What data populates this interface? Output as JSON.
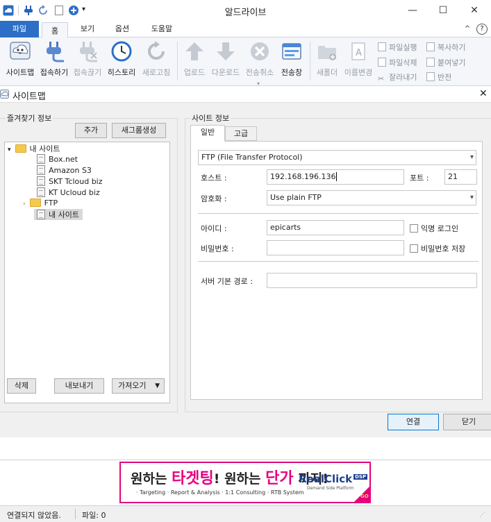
{
  "window": {
    "title": "알드라이브",
    "minimize": "—",
    "maximize": "☐",
    "close": "✕"
  },
  "ribbon_tabs": [
    "파일",
    "홈",
    "보기",
    "옵션",
    "도움말"
  ],
  "ribbon_right": {
    "up": "^",
    "help": "?"
  },
  "ribbon": {
    "large_buttons": [
      {
        "label": "사이트맵",
        "icon": "sitemap-icon"
      },
      {
        "label": "접속하기",
        "icon": "connect-plug-icon"
      },
      {
        "label": "접속끊기",
        "icon": "disconnect-plug-icon"
      },
      {
        "label": "히스토리",
        "icon": "clock-icon"
      },
      {
        "label": "새로고침",
        "icon": "refresh-icon"
      },
      {
        "label": "업로드",
        "icon": "upload-arrow-icon"
      },
      {
        "label": "다운로드",
        "icon": "download-arrow-icon"
      },
      {
        "label": "전송취소",
        "icon": "cancel-icon"
      },
      {
        "label": "전송창",
        "icon": "transfer-window-icon"
      },
      {
        "label": "새폴더",
        "icon": "new-folder-icon"
      },
      {
        "label": "이름변경",
        "icon": "rename-icon"
      }
    ],
    "small_buttons": [
      "파일실행",
      "파일삭제",
      "잘라내기",
      "복사하기",
      "붙여넣기",
      "반전"
    ]
  },
  "dialog": {
    "title": "사이트맵",
    "close": "✕",
    "favorites": {
      "title": "즐겨찾기 정보",
      "add_button": "추가",
      "new_group_button": "새그룹생성",
      "tree": [
        {
          "label": "내 사이트",
          "type": "folder",
          "expanded": true
        },
        {
          "label": "Box.net",
          "type": "site"
        },
        {
          "label": "Amazon S3",
          "type": "site"
        },
        {
          "label": "SKT Tcloud biz",
          "type": "site"
        },
        {
          "label": "KT Ucloud biz",
          "type": "site"
        },
        {
          "label": "FTP",
          "type": "folder",
          "expanded": false
        },
        {
          "label": "내 사이트",
          "type": "site",
          "selected": true
        }
      ],
      "delete_button": "삭제",
      "export_button": "내보내기",
      "import_button": "가져오기"
    },
    "site_info": {
      "title": "사이트 정보",
      "tabs": [
        "일반",
        "고급"
      ],
      "protocol": "FTP (File Transfer Protocol)",
      "host_label": "호스트 :",
      "host_value": "192.168.196.136",
      "port_label": "포트 :",
      "port_value": "21",
      "encryption_label": "암호화 :",
      "encryption_value": "Use plain FTP",
      "id_label": "아이디 :",
      "id_value": "epicarts",
      "anonymous_label": "익명 로그인",
      "password_label": "비밀번호 :",
      "password_value": "",
      "save_password_label": "비밀번호 저장",
      "base_path_label": "서버 기본 경로 :",
      "base_path_value": ""
    },
    "connect_button": "연결",
    "close_button": "닫기"
  },
  "banner": {
    "headline_a": "원하는 ",
    "headline_b": "타겟팅",
    "headline_c": "! 원하는 ",
    "headline_d": "단가",
    "headline_e": " 까지!",
    "sub": "· Targeting · Report & Analysis · 1:1 Consulting · RTB System",
    "brand": "RealClick",
    "brand_tag": "DSP",
    "brand_sub": "Demand Side Platform",
    "go": "GO",
    "colors": {
      "accent": "#e6007e",
      "brand": "#1d3f8f"
    }
  },
  "status": {
    "connection": "연결되지 않았음.",
    "files": "파일: 0"
  }
}
